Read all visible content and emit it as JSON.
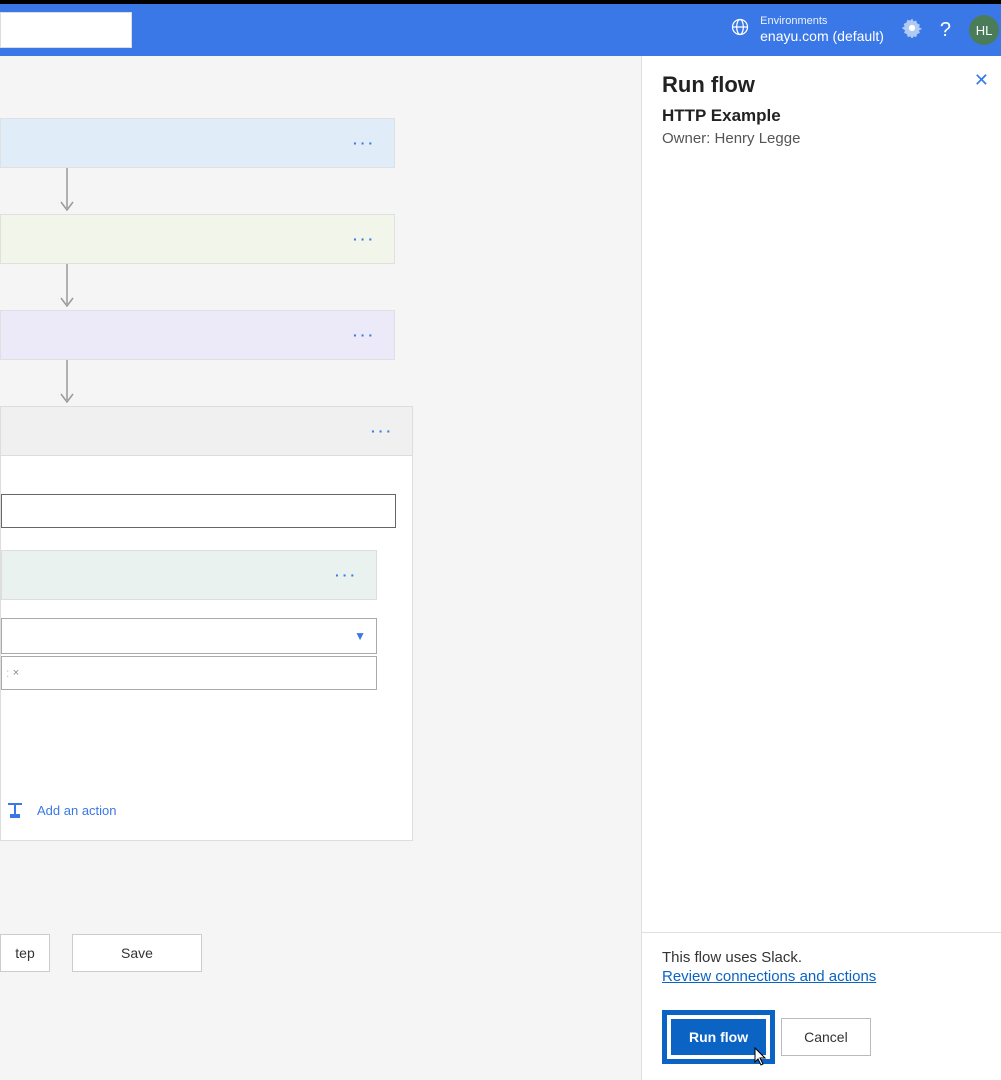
{
  "header": {
    "env_label": "Environments",
    "env_name": "enayu.com (default)",
    "avatar_initials": "HL"
  },
  "flow": {
    "add_action_label": "Add an action",
    "token_close": "×"
  },
  "buttons": {
    "step": "tep",
    "save": "Save"
  },
  "panel": {
    "title": "Run flow",
    "subtitle": "HTTP Example",
    "owner": "Owner: Henry Legge",
    "uses_text": "This flow uses Slack.",
    "review_link": "Review connections and actions",
    "run": "Run flow",
    "cancel": "Cancel"
  }
}
